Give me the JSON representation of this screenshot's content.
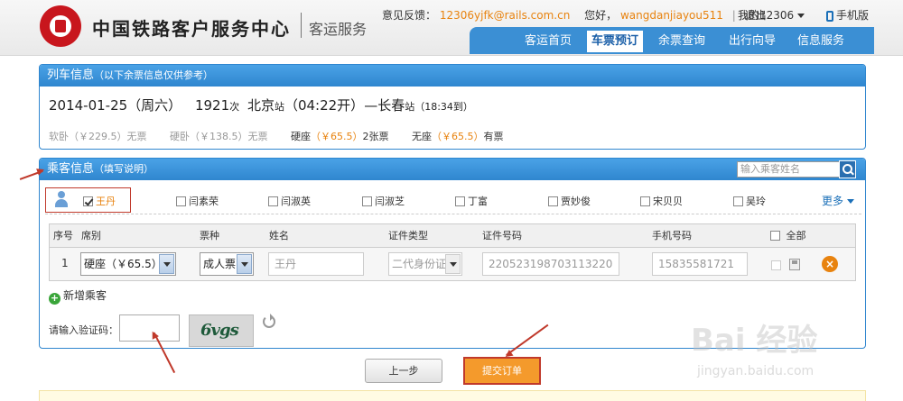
{
  "header": {
    "site_title": "中国铁路客户服务中心",
    "site_sub": "客运服务",
    "feedback_label": "意见反馈：",
    "feedback_email": "12306yjfk@rails.com.cn",
    "greeting": "您好，",
    "username": "wangdanjiayou511",
    "logout": "退出",
    "my12306": "我的12306",
    "mobile": "手机版",
    "nav": [
      "客运首页",
      "车票预订",
      "余票查询",
      "出行向导",
      "信息服务"
    ],
    "nav_active_index": 1
  },
  "train": {
    "panel_title": "列车信息",
    "panel_note": "（以下余票信息仅供参考）",
    "date": "2014-01-25（周六）",
    "number": "1921",
    "number_suffix": "次",
    "from": "北京",
    "from_suffix": "站",
    "depart": "（04:22开）",
    "dash": "—",
    "to": "长春",
    "to_suffix": "站",
    "arrive": "（18:34到）",
    "seats": [
      {
        "name": "软卧",
        "price": "（￥229.5）",
        "status": "无票",
        "available": false
      },
      {
        "name": "硬卧",
        "price": "（￥138.5）",
        "status": "无票",
        "available": false
      },
      {
        "name": "硬座",
        "price": "（￥65.5）",
        "status": "2张票",
        "available": true
      },
      {
        "name": "无座",
        "price": "（￥65.5）",
        "status": "有票",
        "available": true
      }
    ]
  },
  "passenger": {
    "panel_title": "乘客信息",
    "panel_note": "（填写说明）",
    "search_placeholder": "输入乘客姓名",
    "list": [
      "王丹",
      "闫素荣",
      "闫淑英",
      "闫淑芝",
      "丁富",
      "贾妙俊",
      "宋贝贝",
      "吴玲"
    ],
    "selected_index": 0,
    "more": "更多",
    "table_headers": [
      "序号",
      "席别",
      "票种",
      "姓名",
      "证件类型",
      "证件号码",
      "手机号码",
      "全部"
    ],
    "row": {
      "seq": "1",
      "seat": "硬座（￥65.5）",
      "ticket_type": "成人票",
      "name": "王丹",
      "id_type": "二代身份证",
      "id_number": "220523198703113220",
      "phone": "15835581721"
    },
    "add_passenger": "新增乘客",
    "captcha_label": "请输入验证码：",
    "captcha_text": "6vgs"
  },
  "buttons": {
    "prev": "上一步",
    "submit": "提交订单"
  },
  "watermark": {
    "big": "Bai 经验",
    "small": "jingyan.baidu.com"
  },
  "colors": {
    "accent_blue": "#2f86cf",
    "price_orange": "#e8830f",
    "annotation_red": "#c0392b",
    "submit_orange": "#f49a2c"
  }
}
